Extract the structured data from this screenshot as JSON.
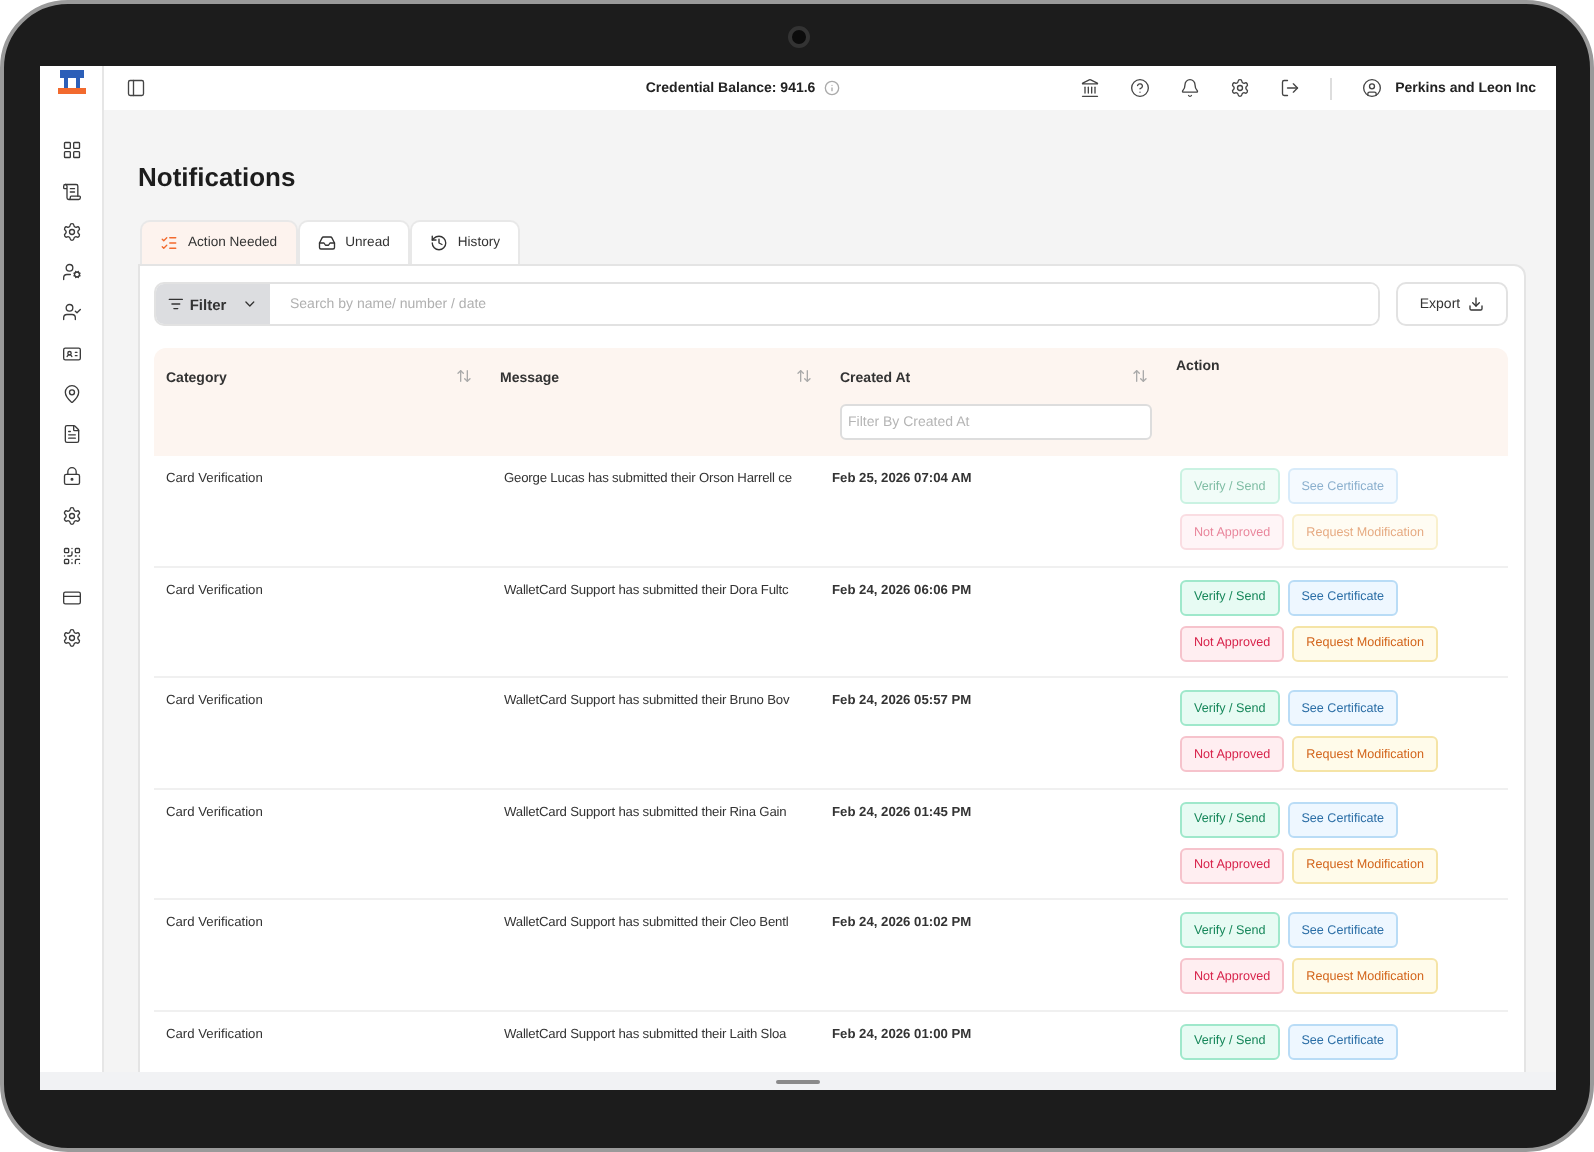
{
  "topbar": {
    "balance_label": "Credential Balance: 941.6",
    "user": "Perkins and Leon Inc"
  },
  "page": {
    "title": "Notifications"
  },
  "tabs": [
    {
      "label": "Action Needed",
      "selected": true
    },
    {
      "label": "Unread",
      "selected": false
    },
    {
      "label": "History",
      "selected": false
    }
  ],
  "toolbar": {
    "filter": "Filter",
    "search": {
      "placeholder": "Search by name/ number / date"
    },
    "export": "Export"
  },
  "table": {
    "columns": [
      {
        "label": "Category",
        "sortable": true
      },
      {
        "label": "Message",
        "sortable": true
      },
      {
        "label": "Created At",
        "sortable": true,
        "filter_placeholder": "Filter By Created At"
      },
      {
        "label": "Action",
        "sortable": false
      }
    ],
    "rows": [
      {
        "category": "Card Verification",
        "message": "George Lucas has submitted their Orson Harrell ce",
        "created_at": "Feb 25, 2026 07:04 AM",
        "actions": [
          {
            "label": "Verify / Send",
            "kind": "verify",
            "disabled": true
          },
          {
            "label": "See Certificate",
            "kind": "certificate",
            "disabled": true
          },
          {
            "label": "Not Approved",
            "kind": "reject",
            "disabled": true
          },
          {
            "label": "Request Modification",
            "kind": "modify",
            "disabled": true
          }
        ]
      },
      {
        "category": "Card Verification",
        "message": "WalletCard Support has submitted their Dora Fultc",
        "created_at": "Feb 24, 2026 06:06 PM",
        "actions": [
          {
            "label": "Verify / Send",
            "kind": "verify",
            "disabled": false
          },
          {
            "label": "See Certificate",
            "kind": "certificate",
            "disabled": false
          },
          {
            "label": "Not Approved",
            "kind": "reject",
            "disabled": false
          },
          {
            "label": "Request Modification",
            "kind": "modify",
            "disabled": false
          }
        ]
      },
      {
        "category": "Card Verification",
        "message": "WalletCard Support has submitted their Bruno Bov",
        "created_at": "Feb 24, 2026 05:57 PM",
        "actions": [
          {
            "label": "Verify / Send",
            "kind": "verify",
            "disabled": false
          },
          {
            "label": "See Certificate",
            "kind": "certificate",
            "disabled": false
          },
          {
            "label": "Not Approved",
            "kind": "reject",
            "disabled": false
          },
          {
            "label": "Request Modification",
            "kind": "modify",
            "disabled": false
          }
        ]
      },
      {
        "category": "Card Verification",
        "message": "WalletCard Support has submitted their Rina Gain",
        "created_at": "Feb 24, 2026 01:45 PM",
        "actions": [
          {
            "label": "Verify / Send",
            "kind": "verify",
            "disabled": false
          },
          {
            "label": "See Certificate",
            "kind": "certificate",
            "disabled": false
          },
          {
            "label": "Not Approved",
            "kind": "reject",
            "disabled": false
          },
          {
            "label": "Request Modification",
            "kind": "modify",
            "disabled": false
          }
        ]
      },
      {
        "category": "Card Verification",
        "message": "WalletCard Support has submitted their Cleo Bentl",
        "created_at": "Feb 24, 2026 01:02 PM",
        "actions": [
          {
            "label": "Verify / Send",
            "kind": "verify",
            "disabled": false
          },
          {
            "label": "See Certificate",
            "kind": "certificate",
            "disabled": false
          },
          {
            "label": "Not Approved",
            "kind": "reject",
            "disabled": false
          },
          {
            "label": "Request Modification",
            "kind": "modify",
            "disabled": false
          }
        ]
      },
      {
        "category": "Card Verification",
        "message": "WalletCard Support has submitted their Laith Sloa",
        "created_at": "Feb 24, 2026 01:00 PM",
        "actions": [
          {
            "label": "Verify / Send",
            "kind": "verify",
            "disabled": false
          },
          {
            "label": "See Certificate",
            "kind": "certificate",
            "disabled": false
          }
        ]
      }
    ]
  }
}
